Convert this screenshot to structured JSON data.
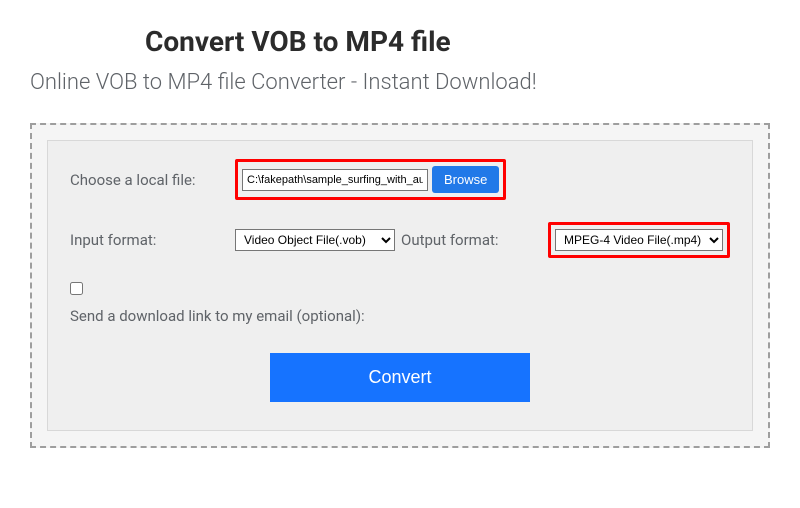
{
  "header": {
    "title": "Convert VOB to MP4 file",
    "subtitle": "Online VOB to MP4 file Converter - Instant Download!"
  },
  "form": {
    "choose_file_label": "Choose a local file:",
    "file_path_value": "C:\\fakepath\\sample_surfing_with_audio.vo",
    "browse_label": "Browse",
    "input_format_label": "Input format:",
    "input_format_value": "Video Object File(.vob)",
    "output_format_label": "Output format:",
    "output_format_value": "MPEG-4 Video File(.mp4)",
    "email_label": "Send a download link to my email (optional):",
    "convert_label": "Convert"
  }
}
